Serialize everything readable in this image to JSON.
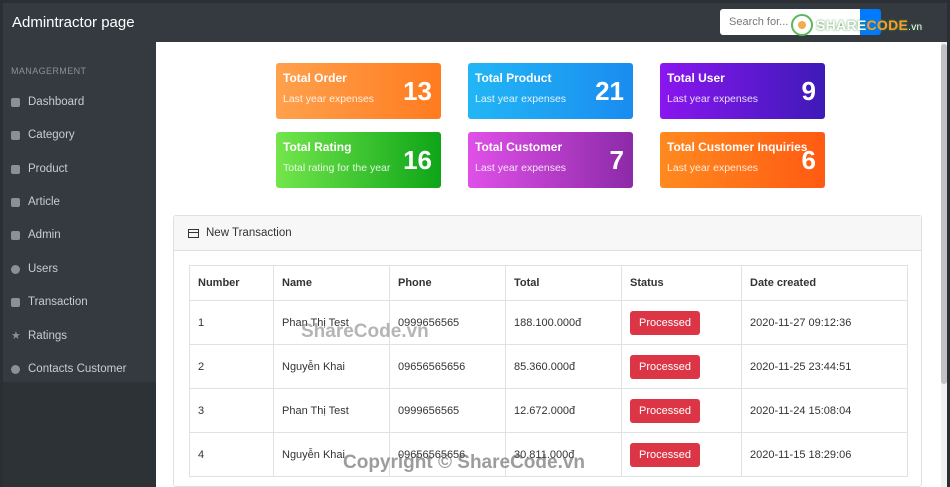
{
  "header": {
    "title": "Admintractor page",
    "search_placeholder": "Search for...",
    "logo": {
      "main": "SHARE",
      "accent": "CODE",
      "suffix": ".vn"
    }
  },
  "sidebar": {
    "heading": "MANAGERMENT",
    "items": [
      {
        "label": "Dashboard",
        "icon": "dashboard-icon"
      },
      {
        "label": "Category",
        "icon": "list-icon"
      },
      {
        "label": "Product",
        "icon": "box-icon"
      },
      {
        "label": "Article",
        "icon": "newspaper-icon"
      },
      {
        "label": "Admin",
        "icon": "id-card-icon"
      },
      {
        "label": "Users",
        "icon": "user-icon"
      },
      {
        "label": "Transaction",
        "icon": "trash-icon"
      },
      {
        "label": "Ratings",
        "icon": "star-icon"
      },
      {
        "label": "Contacts Customer",
        "icon": "question-icon"
      }
    ]
  },
  "cards": [
    {
      "title": "Total Order",
      "subtitle": "Last year expenses",
      "value": "13"
    },
    {
      "title": "Total Product",
      "subtitle": "Last year expenses",
      "value": "21"
    },
    {
      "title": "Total User",
      "subtitle": "Last year expenses",
      "value": "9"
    },
    {
      "title": "Total Rating",
      "subtitle": "Total rating for the year",
      "value": "16"
    },
    {
      "title": "Total Customer",
      "subtitle": "Last year expenses",
      "value": "7"
    },
    {
      "title": "Total Customer Inquiries",
      "subtitle": "Last year expenses",
      "value": "6"
    }
  ],
  "panel": {
    "title": "New Transaction",
    "columns": [
      "Number",
      "Name",
      "Phone",
      "Total",
      "Status",
      "Date created"
    ],
    "rows": [
      {
        "number": "1",
        "name": "Phan Thị Test",
        "phone": "0999656565",
        "total": "188.100.000đ",
        "status": "Processed",
        "date": "2020-11-27 09:12:36"
      },
      {
        "number": "2",
        "name": "Nguyễn Khai",
        "phone": "09656565656",
        "total": "85.360.000đ",
        "status": "Processed",
        "date": "2020-11-25 23:44:51"
      },
      {
        "number": "3",
        "name": "Phan Thị Test",
        "phone": "0999656565",
        "total": "12.672.000đ",
        "status": "Processed",
        "date": "2020-11-24 15:08:04"
      },
      {
        "number": "4",
        "name": "Nguyễn Khai",
        "phone": "09656565656",
        "total": "30.811.000đ",
        "status": "Processed",
        "date": "2020-11-15 18:29:06"
      }
    ]
  },
  "watermarks": {
    "center": "ShareCode.vn",
    "bottom": "Copyright © ShareCode.vn"
  }
}
